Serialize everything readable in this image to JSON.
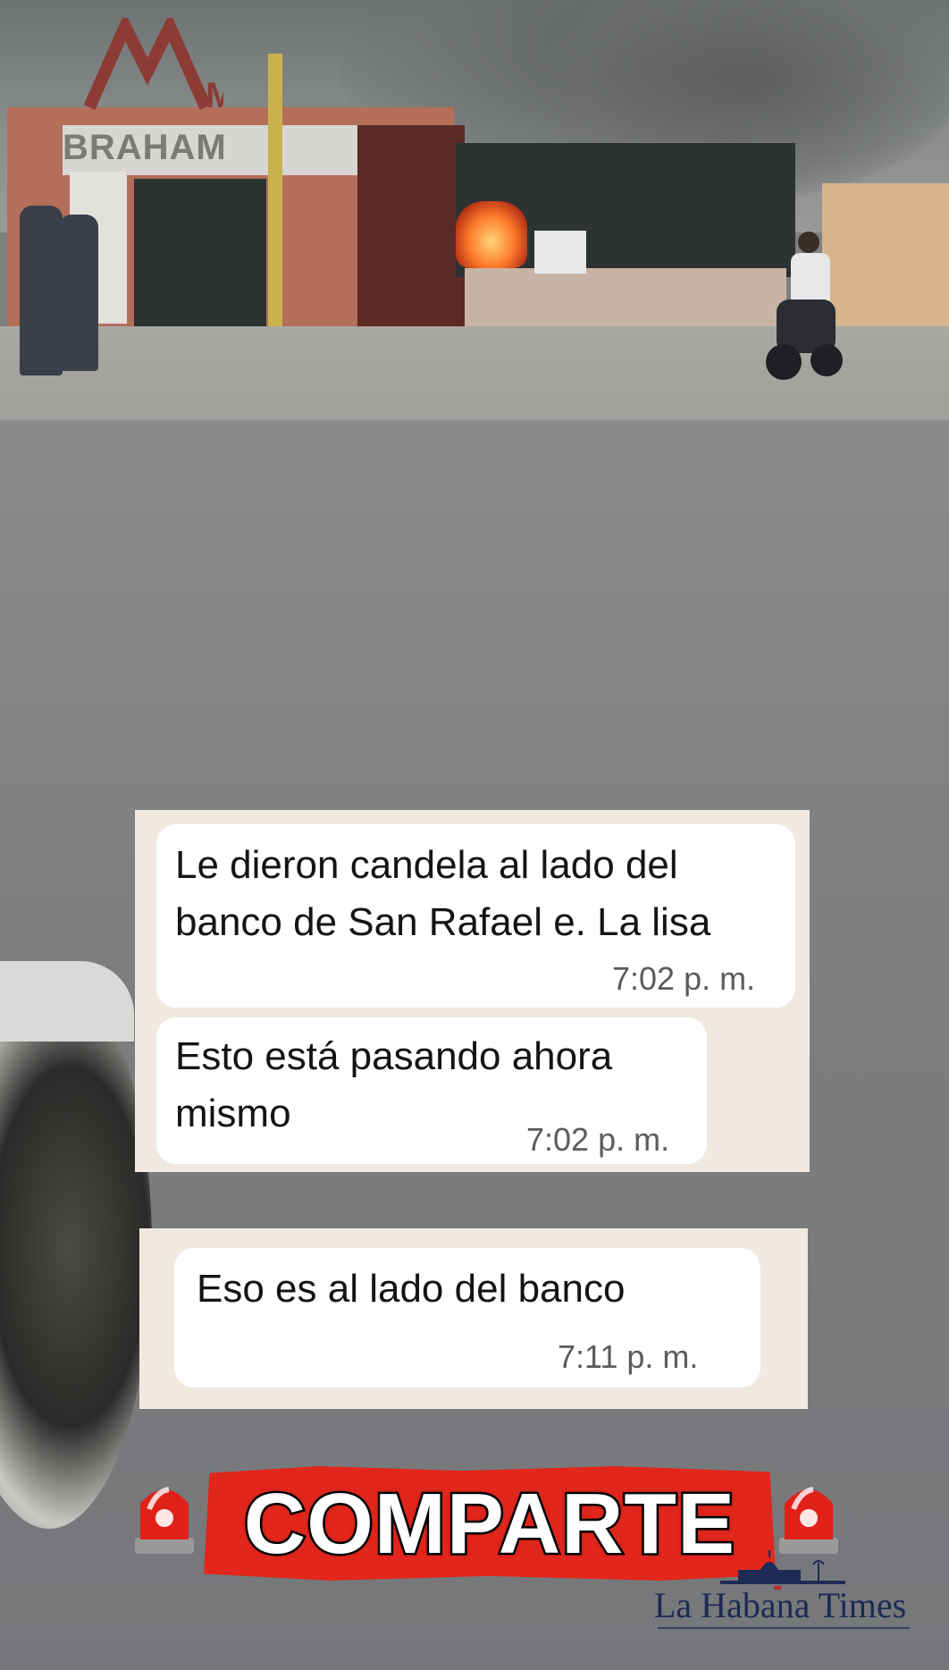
{
  "scene": {
    "store_sign": "BRAHAM",
    "store_logo_letter": "M"
  },
  "chat": {
    "group_1": [
      {
        "lines": [
          "Le dieron candela al lado del",
          "banco de San Rafael e. La lisa"
        ],
        "time": "7:02 p. m."
      },
      {
        "lines": [
          "Esto está pasando ahora",
          "mismo"
        ],
        "time": "7:02 p. m."
      }
    ],
    "group_2": [
      {
        "lines": [
          "Eso es al lado del banco"
        ],
        "time": "7:11 p. m."
      }
    ]
  },
  "banner": {
    "text": "COMPARTE",
    "icon_left": "siren-icon",
    "icon_right": "siren-icon",
    "color": "#e1261c"
  },
  "watermark": {
    "text": "La Habana Times",
    "color": "#1d2a55"
  }
}
